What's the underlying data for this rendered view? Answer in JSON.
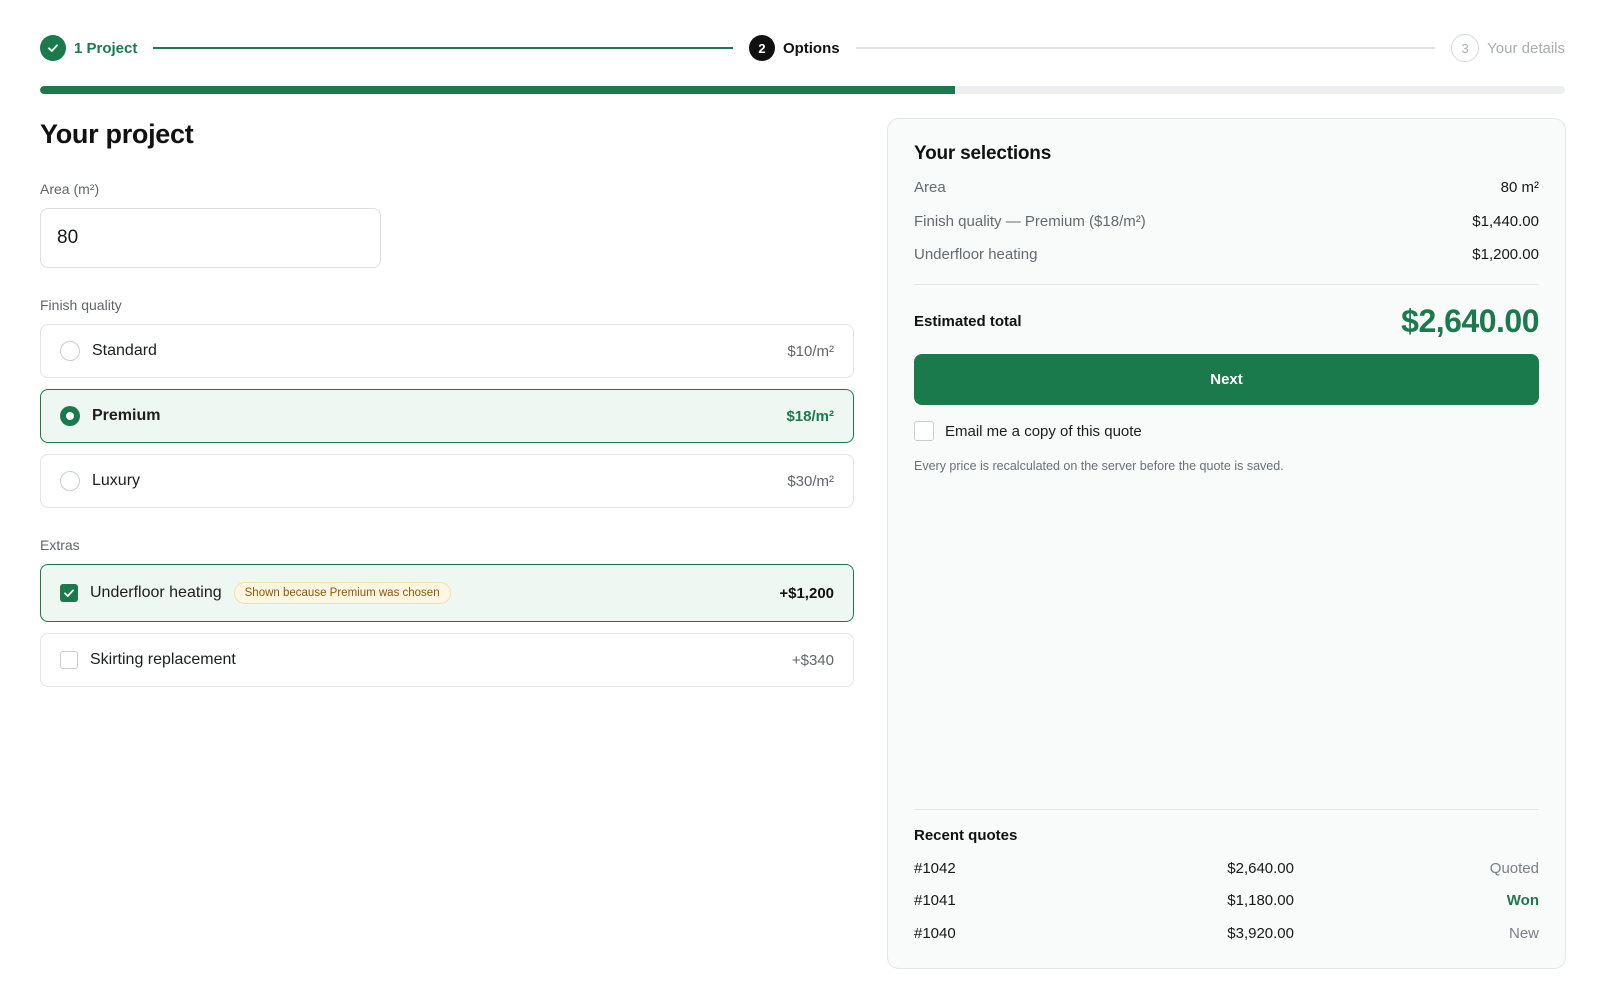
{
  "stepper": {
    "steps": [
      {
        "number": "1",
        "label": "1 Project"
      },
      {
        "number": "2",
        "label": "Options"
      },
      {
        "number": "3",
        "label": "Your details"
      }
    ],
    "progress_percent": 60
  },
  "project": {
    "title": "Your project",
    "area_label": "Area (m²)",
    "area_value": "80",
    "finish_label": "Finish quality",
    "finish_options": [
      {
        "label": "Standard",
        "price": "$10/m²",
        "selected": false
      },
      {
        "label": "Premium",
        "price": "$18/m²",
        "selected": true
      },
      {
        "label": "Luxury",
        "price": "$30/m²",
        "selected": false
      }
    ],
    "extras_label": "Extras",
    "extras": [
      {
        "label": "Underfloor heating",
        "badge": "Shown because Premium was chosen",
        "price": "+$1,200",
        "checked": true
      },
      {
        "label": "Skirting replacement",
        "price": "+$340",
        "checked": false
      }
    ]
  },
  "summary": {
    "title": "Your selections",
    "rows": [
      {
        "label": "Area",
        "value": "80 m²"
      },
      {
        "label": "Finish quality — Premium ($18/m²)",
        "value": "$1,440.00"
      },
      {
        "label": "Underfloor heating",
        "value": "$1,200.00"
      }
    ],
    "total_label": "Estimated total",
    "total_value": "$2,640.00",
    "next_label": "Next",
    "email_label": "Email me a copy of this quote",
    "note": "Every price is recalculated on the server before the quote is saved.",
    "recent_title": "Recent quotes",
    "recent": [
      {
        "id": "#1042",
        "amount": "$2,640.00",
        "status": "Quoted"
      },
      {
        "id": "#1041",
        "amount": "$1,180.00",
        "status": "Won"
      },
      {
        "id": "#1040",
        "amount": "$3,920.00",
        "status": "New"
      }
    ]
  },
  "colors": {
    "accent": "#1b7a4c",
    "selected_bg": "#eff7f2",
    "badge_bg": "#fdf6e3",
    "badge_text": "#8a5a00"
  },
  "icons": {
    "step_done": "check-icon",
    "extra_checked": "check-icon"
  }
}
